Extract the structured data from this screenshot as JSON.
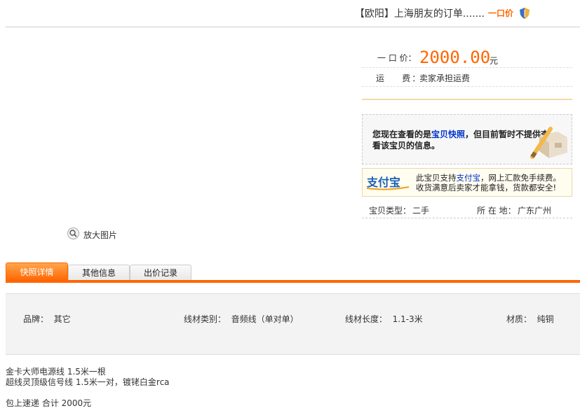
{
  "header": {
    "title": "【欧阳】上海朋友的订单.......",
    "buy_now": "一口价"
  },
  "price": {
    "label": "一 口 价：",
    "value": "2000.00",
    "unit": "元",
    "shipping_label": "运    费：",
    "shipping_value": "卖家承担运费"
  },
  "snapshot_notice": {
    "prefix": "您现在查看的是",
    "link": "宝贝快照",
    "suffix": "，但目前暂时不提供查看该宝贝的信息。"
  },
  "alipay": {
    "logo_text": "支付宝",
    "line1_prefix": "此宝贝支持",
    "line1_link": "支付宝",
    "line1_suffix": "，网上汇款免手续费。",
    "line2": "收货满意后卖家才能拿钱，货款都安全!"
  },
  "item_props": {
    "type_label": "宝贝类型：",
    "type_value": "二手",
    "location_label": "所 在 地：",
    "location_value": "广东广州"
  },
  "zoom": {
    "label": "放大图片"
  },
  "tabs": [
    {
      "label": "快照详情"
    },
    {
      "label": "其他信息"
    },
    {
      "label": "出价记录"
    }
  ],
  "attributes": [
    {
      "text": "品牌：  其它"
    },
    {
      "text": "线材类别：  音频线（单对单）"
    },
    {
      "text": "线材长度：  1.1-3米"
    },
    {
      "text": "材质：  纯铜"
    }
  ],
  "description": [
    "金卡大师电源线 1.5米一根",
    "超线灵顶级信号线 1.5米一对，镀铑白金rca",
    "",
    "包上速递 合计 2000元"
  ],
  "colors": {
    "accent": "#ff6600",
    "link": "#0033cc"
  }
}
